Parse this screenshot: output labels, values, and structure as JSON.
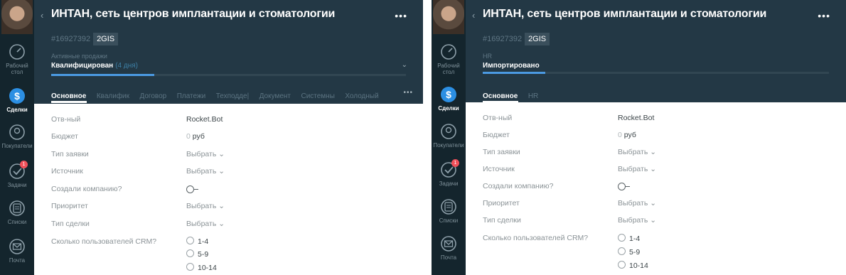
{
  "left": {
    "sidebar": {
      "items": [
        {
          "label": "Рабочий стол"
        },
        {
          "label": "Сделки"
        },
        {
          "label": "Покупатели"
        },
        {
          "label": "Задачи",
          "badge": "1"
        },
        {
          "label": "Списки"
        },
        {
          "label": "Почта"
        }
      ]
    },
    "header": {
      "title": "ИНТАН, сеть центров имплантации и стоматологии",
      "lead_id": "#16927392",
      "tag": "2GIS",
      "pipeline": "Активные продажи",
      "status": "Квалифицирован",
      "status_days": "(4 дня)",
      "progress": 0.29
    },
    "tabs": [
      "Основное",
      "Квалифик",
      "Договор",
      "Платежи",
      "Техподде|",
      "Документ",
      "Системны",
      "Холодный"
    ],
    "fields": {
      "responsible": {
        "label": "Отв-ный",
        "value": "Rocket.Bot"
      },
      "budget": {
        "label": "Бюджет",
        "zero": "0",
        "unit": "руб"
      },
      "request_type": {
        "label": "Тип заявки",
        "value": "Выбрать"
      },
      "source": {
        "label": "Источник",
        "value": "Выбрать"
      },
      "company_created": {
        "label": "Создали компанию?"
      },
      "priority": {
        "label": "Приоритет",
        "value": "Выбрать"
      },
      "deal_type": {
        "label": "Тип сделки",
        "value": "Выбрать"
      },
      "crm_users": {
        "label": "Сколько пользователей CRM?",
        "options": [
          "1-4",
          "5-9",
          "10-14"
        ]
      }
    }
  },
  "right": {
    "sidebar": {
      "items": [
        {
          "label": "Рабочий стол"
        },
        {
          "label": "Сделки"
        },
        {
          "label": "Покупатели"
        },
        {
          "label": "Задачи",
          "badge": "1"
        },
        {
          "label": "Списки"
        },
        {
          "label": "Почта"
        }
      ]
    },
    "header": {
      "title": "ИНТАН, сеть центров имплантации и стоматологии",
      "lead_id": "#16927392",
      "tag": "2GIS",
      "pipeline": "HR",
      "status": "Импортировано",
      "progress": 0.18
    },
    "tabs": [
      "Основное",
      "HR"
    ],
    "fields": {
      "responsible": {
        "label": "Отв-ный",
        "value": "Rocket.Bot"
      },
      "budget": {
        "label": "Бюджет",
        "zero": "0",
        "unit": "руб"
      },
      "request_type": {
        "label": "Тип заявки",
        "value": "Выбрать"
      },
      "source": {
        "label": "Источник",
        "value": "Выбрать"
      },
      "company_created": {
        "label": "Создали компанию?"
      },
      "priority": {
        "label": "Приоритет",
        "value": "Выбрать"
      },
      "deal_type": {
        "label": "Тип сделки",
        "value": "Выбрать"
      },
      "crm_users": {
        "label": "Сколько пользователей CRM?",
        "options": [
          "1-4",
          "5-9",
          "10-14"
        ]
      }
    }
  },
  "colors": {
    "sidebar_bg": "#14252d",
    "header_bg": "#233845",
    "progress": "#4b9ae2",
    "badge": "#f0505a"
  },
  "icons": [
    "dashboard-icon",
    "deals-icon",
    "customers-icon",
    "tasks-icon",
    "lists-icon",
    "mail-icon",
    "back-icon",
    "more-icon",
    "chevron-down-icon"
  ]
}
